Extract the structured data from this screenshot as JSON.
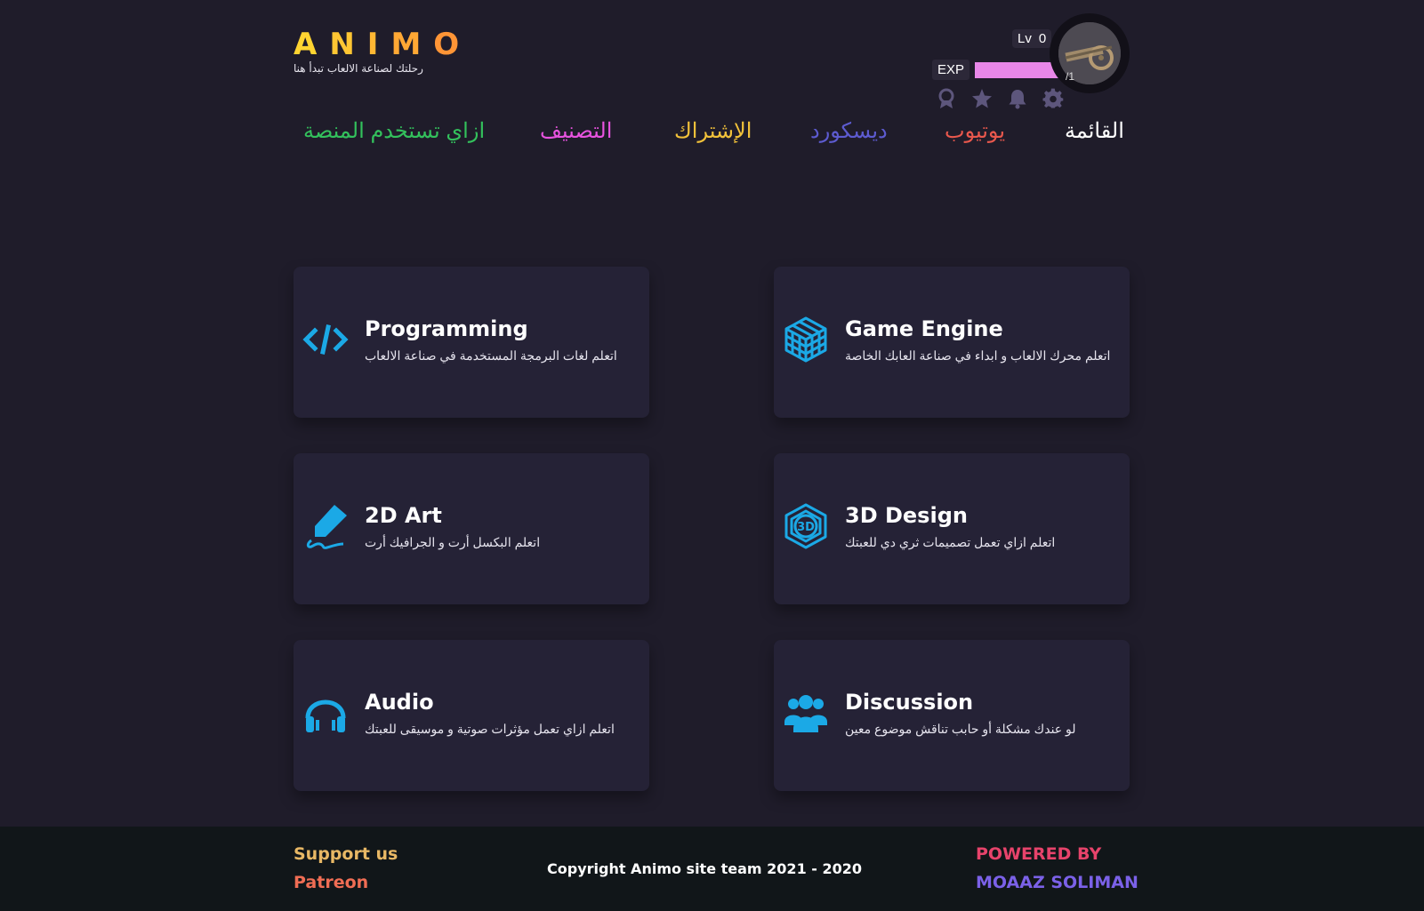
{
  "brand": {
    "letters": [
      "A",
      "N",
      "I",
      "M",
      "O"
    ],
    "letter_colors": [
      "#ffd431",
      "#ffc633",
      "#ffb733",
      "#ffa834",
      "#ff9536"
    ],
    "tagline": "رحلتك لصناعة الالعاب تبدأ هنا"
  },
  "user": {
    "level_label": "Lv",
    "level_value": "0",
    "exp_label": "EXP",
    "exp_fraction": 0.95,
    "exp_value": "/1",
    "exp_color": "#e887e8",
    "icons": [
      "badge-icon",
      "star-icon",
      "bell-icon",
      "gear-icon"
    ]
  },
  "nav": {
    "items": [
      {
        "label": "القائمة",
        "color": "#ffffff"
      },
      {
        "label": "يوتيوب",
        "color": "#e9584d"
      },
      {
        "label": "ديسكورد",
        "color": "#5d5bd0"
      },
      {
        "label": "الإشتراك",
        "color": "#f2c23a"
      },
      {
        "label": "التصنيف",
        "color": "#e853e0"
      },
      {
        "label": "ازاي تستخدم المنصة",
        "color": "#33c15c"
      }
    ]
  },
  "accent_color": "#1ba9e6",
  "cards": [
    {
      "title": "Programming",
      "desc": "اتعلم لغات البرمجة المستخدمة في صناعة الالعاب",
      "icon": "code-icon"
    },
    {
      "title": "Game Engine",
      "desc": "اتعلم محرك الالعاب و ابداء في صناعة العابك الخاصة",
      "icon": "cube-grid-icon"
    },
    {
      "title": "2D Art",
      "desc": "اتعلم البكسل أرت و الجرافيك أرت",
      "icon": "marker-pen-icon"
    },
    {
      "title": "3D Design",
      "desc": "اتعلم ازاي تعمل تصميمات ثري دي للعبتك",
      "icon": "3d-cube-icon"
    },
    {
      "title": "Audio",
      "desc": "اتعلم ازاي تعمل مؤثرات صوتية و موسيقى للعبتك",
      "icon": "headphones-icon"
    },
    {
      "title": "Discussion",
      "desc": "لو عندك مشكلة أو حابب تناقش موضوع معين",
      "icon": "users-icon"
    }
  ],
  "footer": {
    "support": "Support us",
    "patreon": "Patreon",
    "copyright": "Copyright Animo site team 2021 - 2020",
    "powered_by": "POWERED BY",
    "author": "MOAAZ SOLIMAN"
  }
}
